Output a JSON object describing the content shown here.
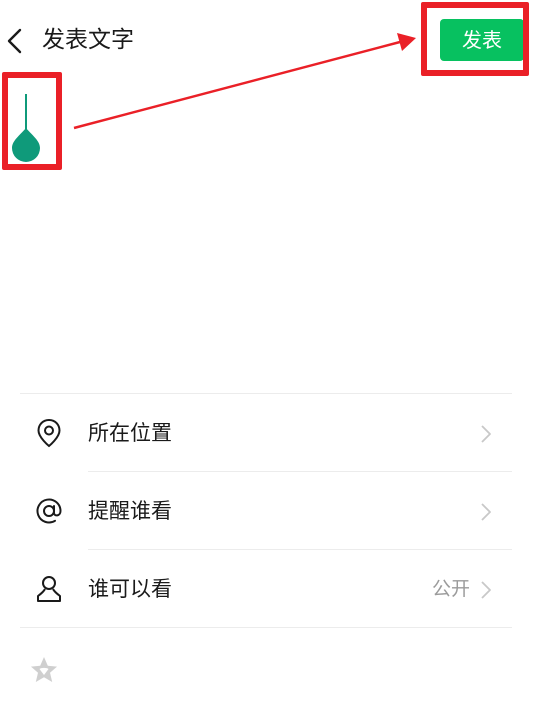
{
  "header": {
    "title": "发表文字",
    "publish_label": "发表"
  },
  "editor": {
    "value": ""
  },
  "options": [
    {
      "label": "所在位置",
      "icon": "location-pin-icon",
      "value": ""
    },
    {
      "label": "提醒谁看",
      "icon": "at-sign-icon",
      "value": ""
    },
    {
      "label": "谁可以看",
      "icon": "person-icon",
      "value": "公开"
    }
  ],
  "bottom_bar": {
    "icon": "emoji-star-icon"
  },
  "colors": {
    "accent": "#07c160",
    "annotation": "#ea2027",
    "cursor": "#0f9a7a"
  }
}
